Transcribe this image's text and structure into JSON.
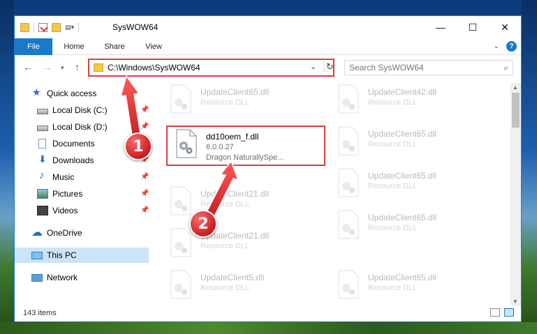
{
  "window": {
    "title": "SysWOW64",
    "controls": {
      "minimize": "—",
      "maximize": "☐",
      "close": "✕"
    }
  },
  "ribbon": {
    "tabs": [
      "File",
      "Home",
      "Share",
      "View"
    ],
    "help": "?"
  },
  "address": {
    "path": "C:\\Windows\\SysWOW64",
    "search_placeholder": "Search SysWOW64"
  },
  "sidebar": {
    "items": [
      {
        "label": "Quick access",
        "icon": "star-icon"
      },
      {
        "label": "Local Disk (C:)",
        "icon": "disk-icon",
        "pinned": true
      },
      {
        "label": "Local Disk (D:)",
        "icon": "disk-icon",
        "pinned": true
      },
      {
        "label": "Documents",
        "icon": "documents-icon",
        "pinned": true
      },
      {
        "label": "Downloads",
        "icon": "downloads-icon",
        "pinned": true
      },
      {
        "label": "Music",
        "icon": "music-icon",
        "pinned": true
      },
      {
        "label": "Pictures",
        "icon": "pictures-icon",
        "pinned": true
      },
      {
        "label": "Videos",
        "icon": "videos-icon",
        "pinned": true
      },
      {
        "label": "OneDrive",
        "icon": "onedrive-icon"
      },
      {
        "label": "This PC",
        "icon": "pc-icon",
        "selected": true
      },
      {
        "label": "Network",
        "icon": "network-icon"
      }
    ]
  },
  "files": {
    "left": [
      {
        "name": "UpdateClient65.dll",
        "type": "Resource DLL"
      },
      {
        "name": "dd10oem_f.dll",
        "version": "6.0.0.27",
        "company": "Dragon NaturallySpe..."
      },
      {
        "name": "UpdateClient21.dll",
        "type": "Resource DLL"
      },
      {
        "name": "UpdateClient21.dll",
        "type": "Resource DLL"
      },
      {
        "name": "UpdateClient5.dll",
        "type": "Resource DLL"
      }
    ],
    "right": [
      {
        "name": "UpdateClient42.dll",
        "type": "Resource DLL"
      },
      {
        "name": "UpdateClient65.dll",
        "type": "Resource DLL"
      },
      {
        "name": "UpdateClient65.dll",
        "type": "Resource DLL"
      },
      {
        "name": "UpdateClient65.dll",
        "type": "Resource DLL"
      },
      {
        "name": "UpdateClient65.dll",
        "type": "Resource DLL"
      }
    ]
  },
  "status": {
    "count": "143 items"
  },
  "callouts": [
    "1",
    "2"
  ],
  "colors": {
    "accent": "#1979ca",
    "highlight": "#d94040",
    "selected": "#cce4f7"
  }
}
